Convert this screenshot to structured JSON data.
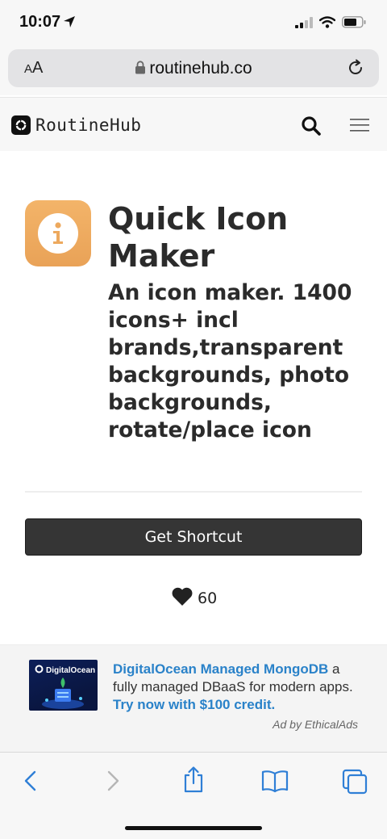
{
  "status_bar": {
    "time": "10:07",
    "icons": [
      "location-arrow-icon",
      "cellular-signal-icon",
      "wifi-icon",
      "battery-icon"
    ]
  },
  "browser": {
    "text_size_label": "AA",
    "url": "routinehub.co",
    "icons": [
      "lock-icon",
      "reload-icon"
    ]
  },
  "site_header": {
    "brand_name": "RoutineHub",
    "icons": [
      "routinehub-logo-icon",
      "search-icon",
      "menu-icon"
    ]
  },
  "shortcut": {
    "icon_name": "info-icon",
    "icon_color": "#eda95e",
    "title": "Quick Icon Maker",
    "description": "An icon maker. 1400 icons+ incl brands,transparent backgrounds, photo backgrounds, rotate/place icon",
    "get_button_label": "Get Shortcut",
    "likes": "60"
  },
  "ad": {
    "image_brand": "DigitalOcean",
    "headline": "DigitalOcean Managed MongoDB",
    "body": " a fully managed DBaaS for modern apps. ",
    "cta": "Try now with $100 credit.",
    "attribution": "Ad by EthicalAds",
    "link_color": "#2a82c9"
  },
  "toolbar": {
    "icons": [
      "back-icon",
      "forward-icon",
      "share-icon",
      "bookmarks-icon",
      "tabs-icon"
    ],
    "accent_color": "#2f7fd6"
  }
}
